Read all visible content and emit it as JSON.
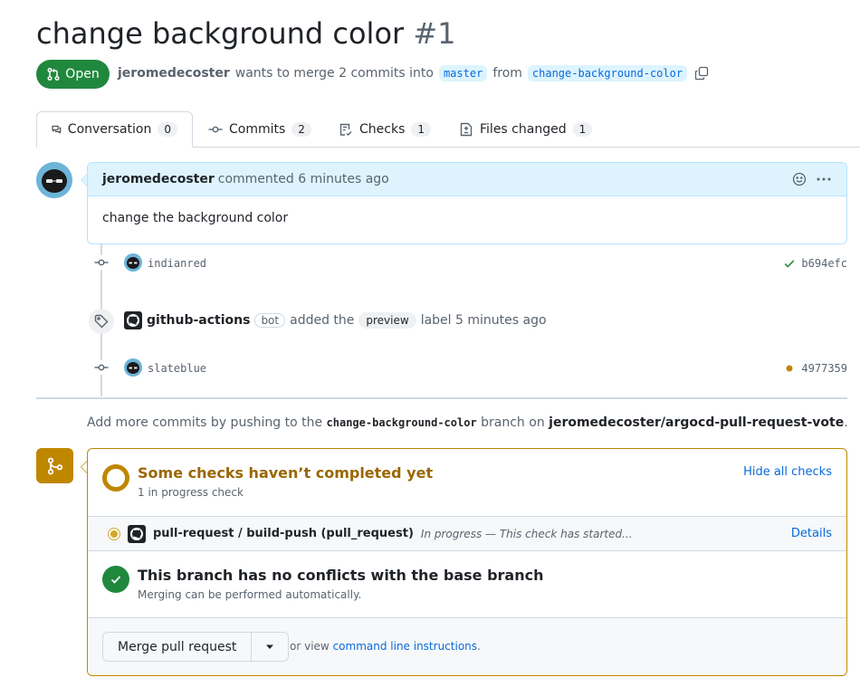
{
  "pr": {
    "title": "change background color",
    "number": "#1",
    "state": "Open",
    "author": "jeromedecoster",
    "merge_text": "wants to merge 2 commits into",
    "base_branch": "master",
    "from_text": "from",
    "head_branch": "change-background-color"
  },
  "tabs": [
    {
      "label": "Conversation",
      "count": "0",
      "icon": "comment-discussion-icon"
    },
    {
      "label": "Commits",
      "count": "2",
      "icon": "git-commit-icon"
    },
    {
      "label": "Checks",
      "count": "1",
      "icon": "checklist-icon"
    },
    {
      "label": "Files changed",
      "count": "1",
      "icon": "file-diff-icon"
    }
  ],
  "comment": {
    "author": "jeromedecoster",
    "meta": "commented 6 minutes ago",
    "body": "change the background color"
  },
  "timeline": {
    "commit1": {
      "message": "indianred",
      "sha": "b694efc",
      "status": "success"
    },
    "label_event": {
      "actor": "github-actions",
      "badge": "bot",
      "action": "added the",
      "label": "preview",
      "suffix": "label 5 minutes ago"
    },
    "commit2": {
      "message": "slateblue",
      "sha": "4977359",
      "status": "pending"
    }
  },
  "push_hint": {
    "prefix": "Add more commits by pushing to the",
    "branch": "change-background-color",
    "middle": "branch on",
    "repo": "jeromedecoster/argocd-pull-request-vote",
    "suffix": "."
  },
  "merge_box": {
    "checks_title": "Some checks haven’t completed yet",
    "checks_sub": "1 in progress check",
    "hide_link": "Hide all checks",
    "check_name": "pull-request / build-push (pull_request)",
    "check_status": "In progress — This check has started...",
    "details_link": "Details",
    "conflicts_title": "This branch has no conflicts with the base branch",
    "conflicts_sub": "Merging can be performed automatically.",
    "merge_button": "Merge pull request",
    "or_view": "or view",
    "cli_link": "command line instructions",
    "cli_suffix": "."
  },
  "colors": {
    "open_green": "#1f883d",
    "pending_yellow": "#bf8700",
    "link_blue": "#0969da"
  }
}
